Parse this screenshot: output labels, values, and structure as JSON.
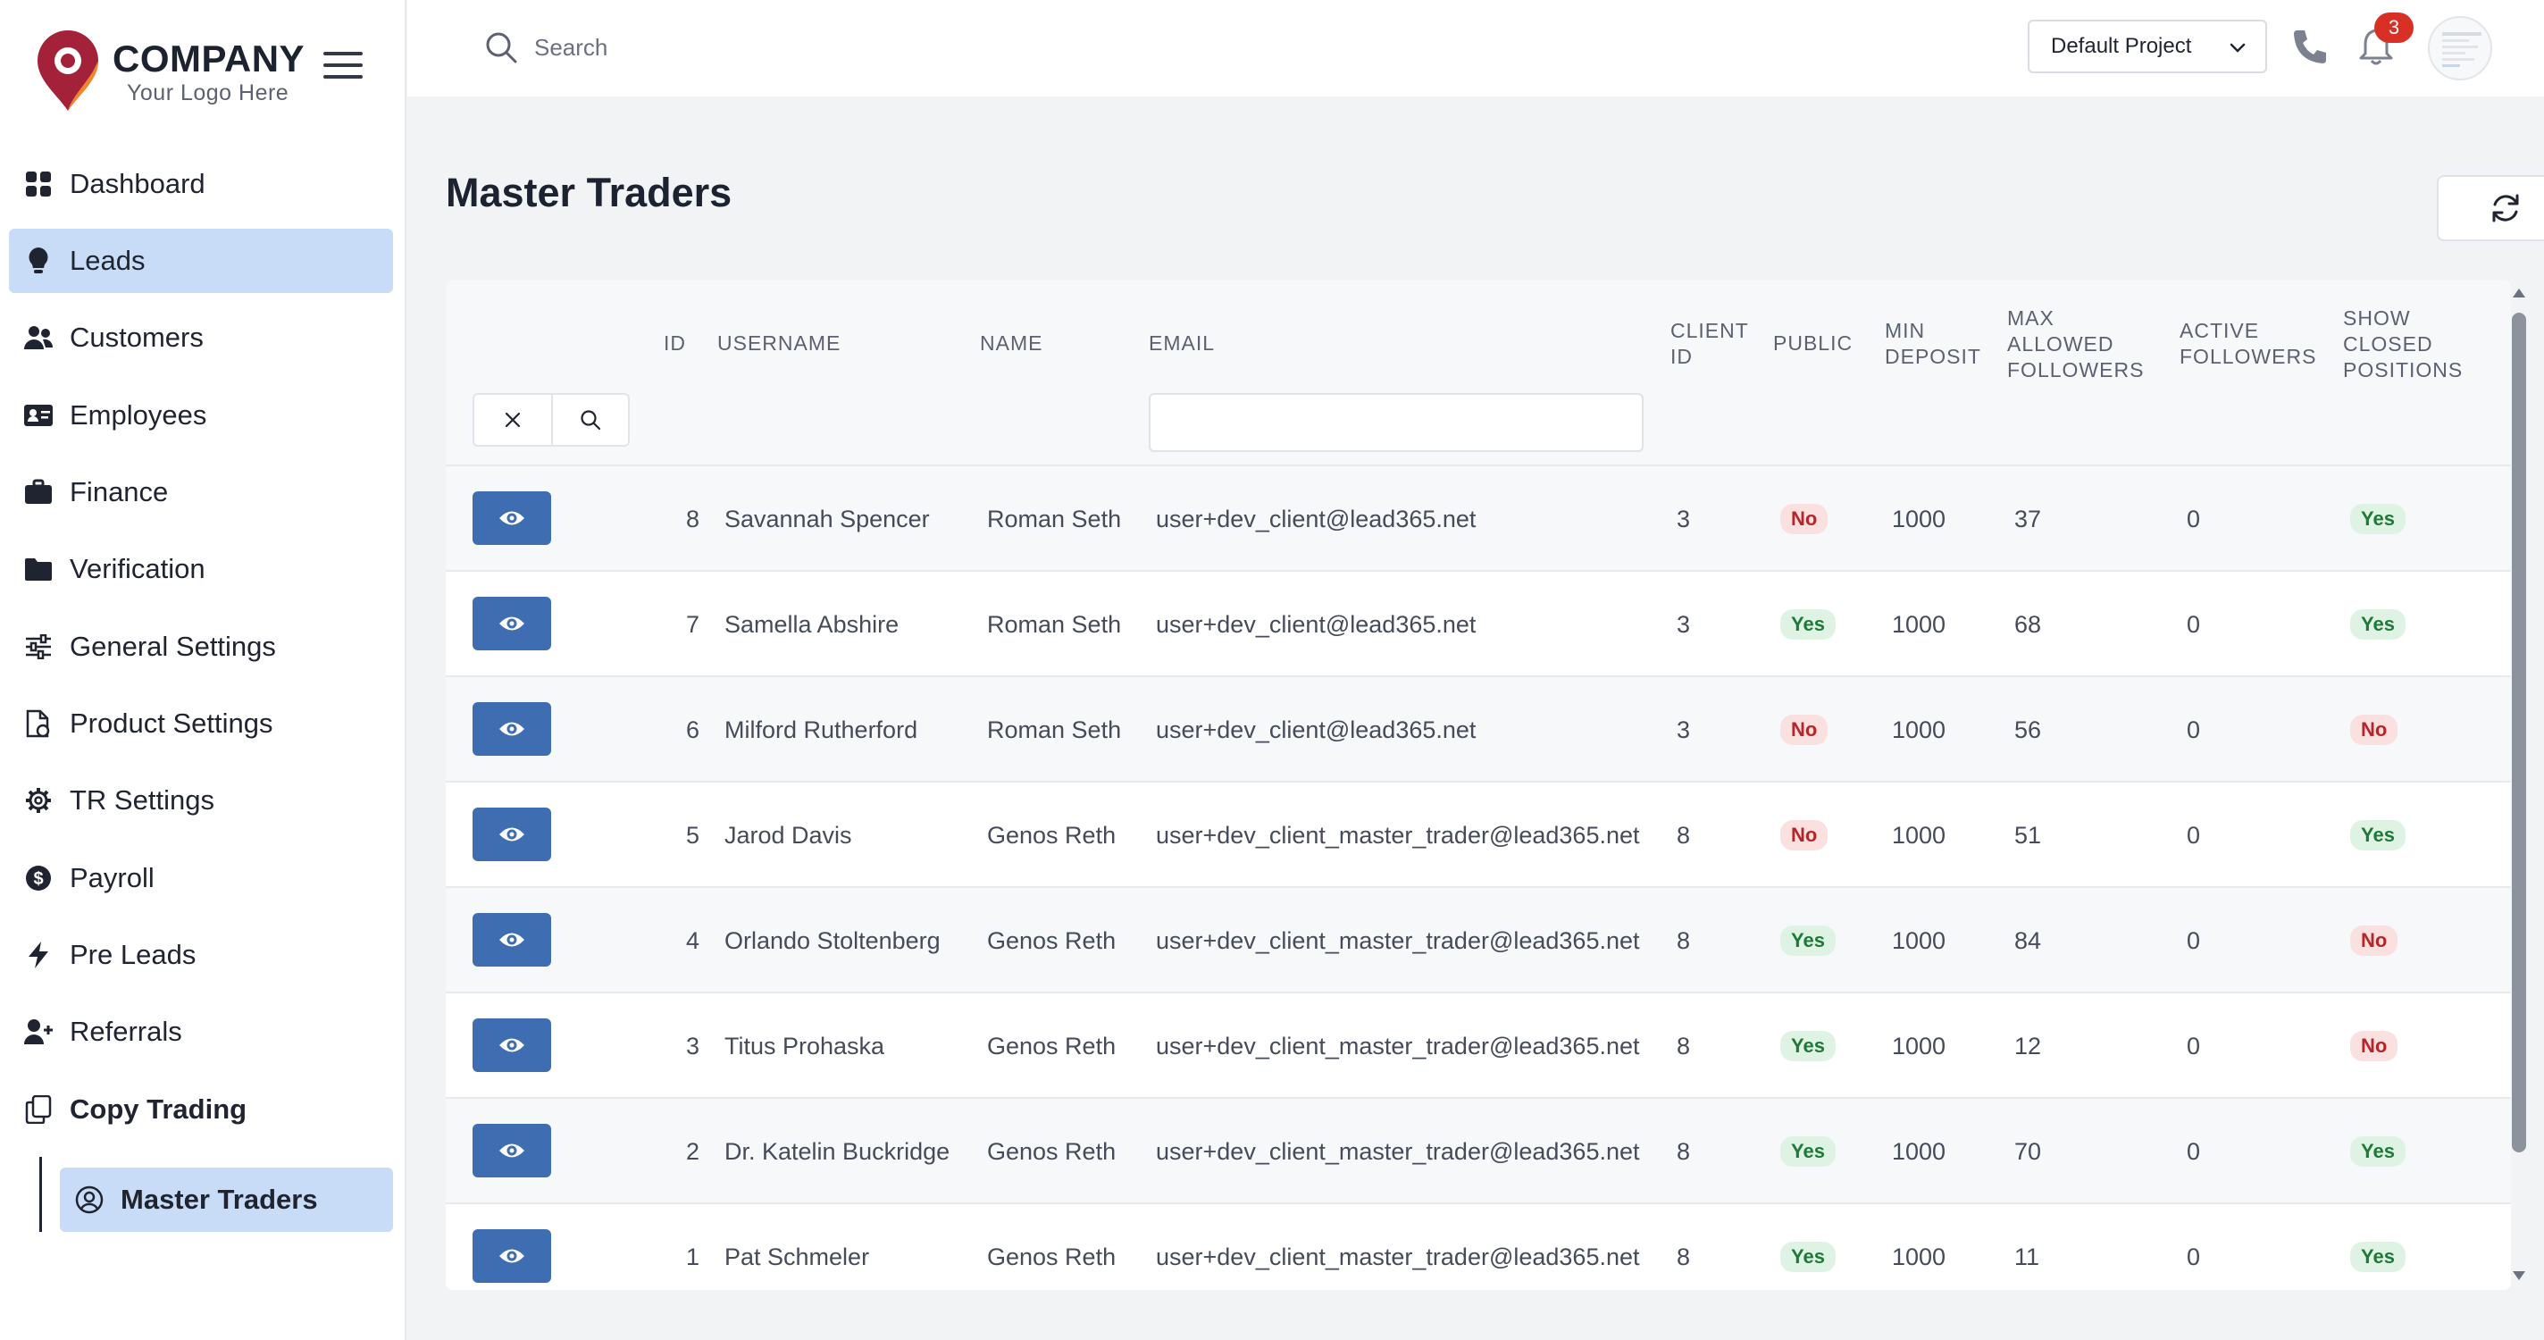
{
  "brand": {
    "name": "COMPANY",
    "tagline": "Your Logo Here"
  },
  "sidebar": {
    "items": [
      {
        "label": "Dashboard",
        "icon": "grid-icon"
      },
      {
        "label": "Leads",
        "icon": "lightbulb-icon",
        "active": true
      },
      {
        "label": "Customers",
        "icon": "users-icon"
      },
      {
        "label": "Employees",
        "icon": "id-card-icon"
      },
      {
        "label": "Finance",
        "icon": "briefcase-icon"
      },
      {
        "label": "Verification",
        "icon": "folder-icon"
      },
      {
        "label": "General Settings",
        "icon": "sliders-icon"
      },
      {
        "label": "Product Settings",
        "icon": "document-icon"
      },
      {
        "label": "TR Settings",
        "icon": "gear-icon"
      },
      {
        "label": "Payroll",
        "icon": "dollar-circle-icon"
      },
      {
        "label": "Pre Leads",
        "icon": "bolt-icon"
      },
      {
        "label": "Referrals",
        "icon": "user-plus-icon"
      },
      {
        "label": "Copy Trading",
        "icon": "copy-icon",
        "bold": true
      }
    ],
    "sub_item": {
      "label": "Master Traders",
      "icon": "user-circle-icon",
      "active": true
    }
  },
  "topbar": {
    "search_placeholder": "Search",
    "project": "Default Project",
    "notification_count": "3"
  },
  "page": {
    "title": "Master Traders"
  },
  "table": {
    "headers": {
      "id": "ID",
      "username": "USERNAME",
      "name": "NAME",
      "email": "EMAIL",
      "client_id": [
        "CLIENT",
        "ID"
      ],
      "public": "PUBLIC",
      "min_deposit": [
        "MIN",
        "DEPOSIT"
      ],
      "max_followers": [
        "MAX",
        "ALLOWED",
        "FOLLOWERS"
      ],
      "active_followers": [
        "ACTIVE",
        "FOLLOWERS"
      ],
      "show_closed": [
        "SHOW",
        "CLOSED",
        "POSITIONS"
      ]
    },
    "email_filter_value": "",
    "rows": [
      {
        "id": "8",
        "username": "Savannah Spencer",
        "name": "Roman Seth",
        "email": "user+dev_client@lead365.net",
        "client_id": "3",
        "public": "No",
        "min_deposit": "1000",
        "max_followers": "37",
        "active_followers": "0",
        "show_closed": "Yes"
      },
      {
        "id": "7",
        "username": "Samella Abshire",
        "name": "Roman Seth",
        "email": "user+dev_client@lead365.net",
        "client_id": "3",
        "public": "Yes",
        "min_deposit": "1000",
        "max_followers": "68",
        "active_followers": "0",
        "show_closed": "Yes"
      },
      {
        "id": "6",
        "username": "Milford Rutherford",
        "name": "Roman Seth",
        "email": "user+dev_client@lead365.net",
        "client_id": "3",
        "public": "No",
        "min_deposit": "1000",
        "max_followers": "56",
        "active_followers": "0",
        "show_closed": "No"
      },
      {
        "id": "5",
        "username": "Jarod Davis",
        "name": "Genos Reth",
        "email": "user+dev_client_master_trader@lead365.net",
        "client_id": "8",
        "public": "No",
        "min_deposit": "1000",
        "max_followers": "51",
        "active_followers": "0",
        "show_closed": "Yes"
      },
      {
        "id": "4",
        "username": "Orlando Stoltenberg",
        "name": "Genos Reth",
        "email": "user+dev_client_master_trader@lead365.net",
        "client_id": "8",
        "public": "Yes",
        "min_deposit": "1000",
        "max_followers": "84",
        "active_followers": "0",
        "show_closed": "No"
      },
      {
        "id": "3",
        "username": "Titus Prohaska",
        "name": "Genos Reth",
        "email": "user+dev_client_master_trader@lead365.net",
        "client_id": "8",
        "public": "Yes",
        "min_deposit": "1000",
        "max_followers": "12",
        "active_followers": "0",
        "show_closed": "No"
      },
      {
        "id": "2",
        "username": "Dr. Katelin Buckridge",
        "name": "Genos Reth",
        "email": "user+dev_client_master_trader@lead365.net",
        "client_id": "8",
        "public": "Yes",
        "min_deposit": "1000",
        "max_followers": "70",
        "active_followers": "0",
        "show_closed": "Yes"
      },
      {
        "id": "1",
        "username": "Pat Schmeler",
        "name": "Genos Reth",
        "email": "user+dev_client_master_trader@lead365.net",
        "client_id": "8",
        "public": "Yes",
        "min_deposit": "1000",
        "max_followers": "11",
        "active_followers": "0",
        "show_closed": "Yes"
      }
    ]
  },
  "colors": {
    "accent": "#3e6db2",
    "nav_active": "#c8dcf7",
    "logo_red": "#a3223a",
    "logo_orange": "#f0862a",
    "badge_yes_bg": "#dff3e4",
    "badge_no_bg": "#fbe0e0"
  }
}
